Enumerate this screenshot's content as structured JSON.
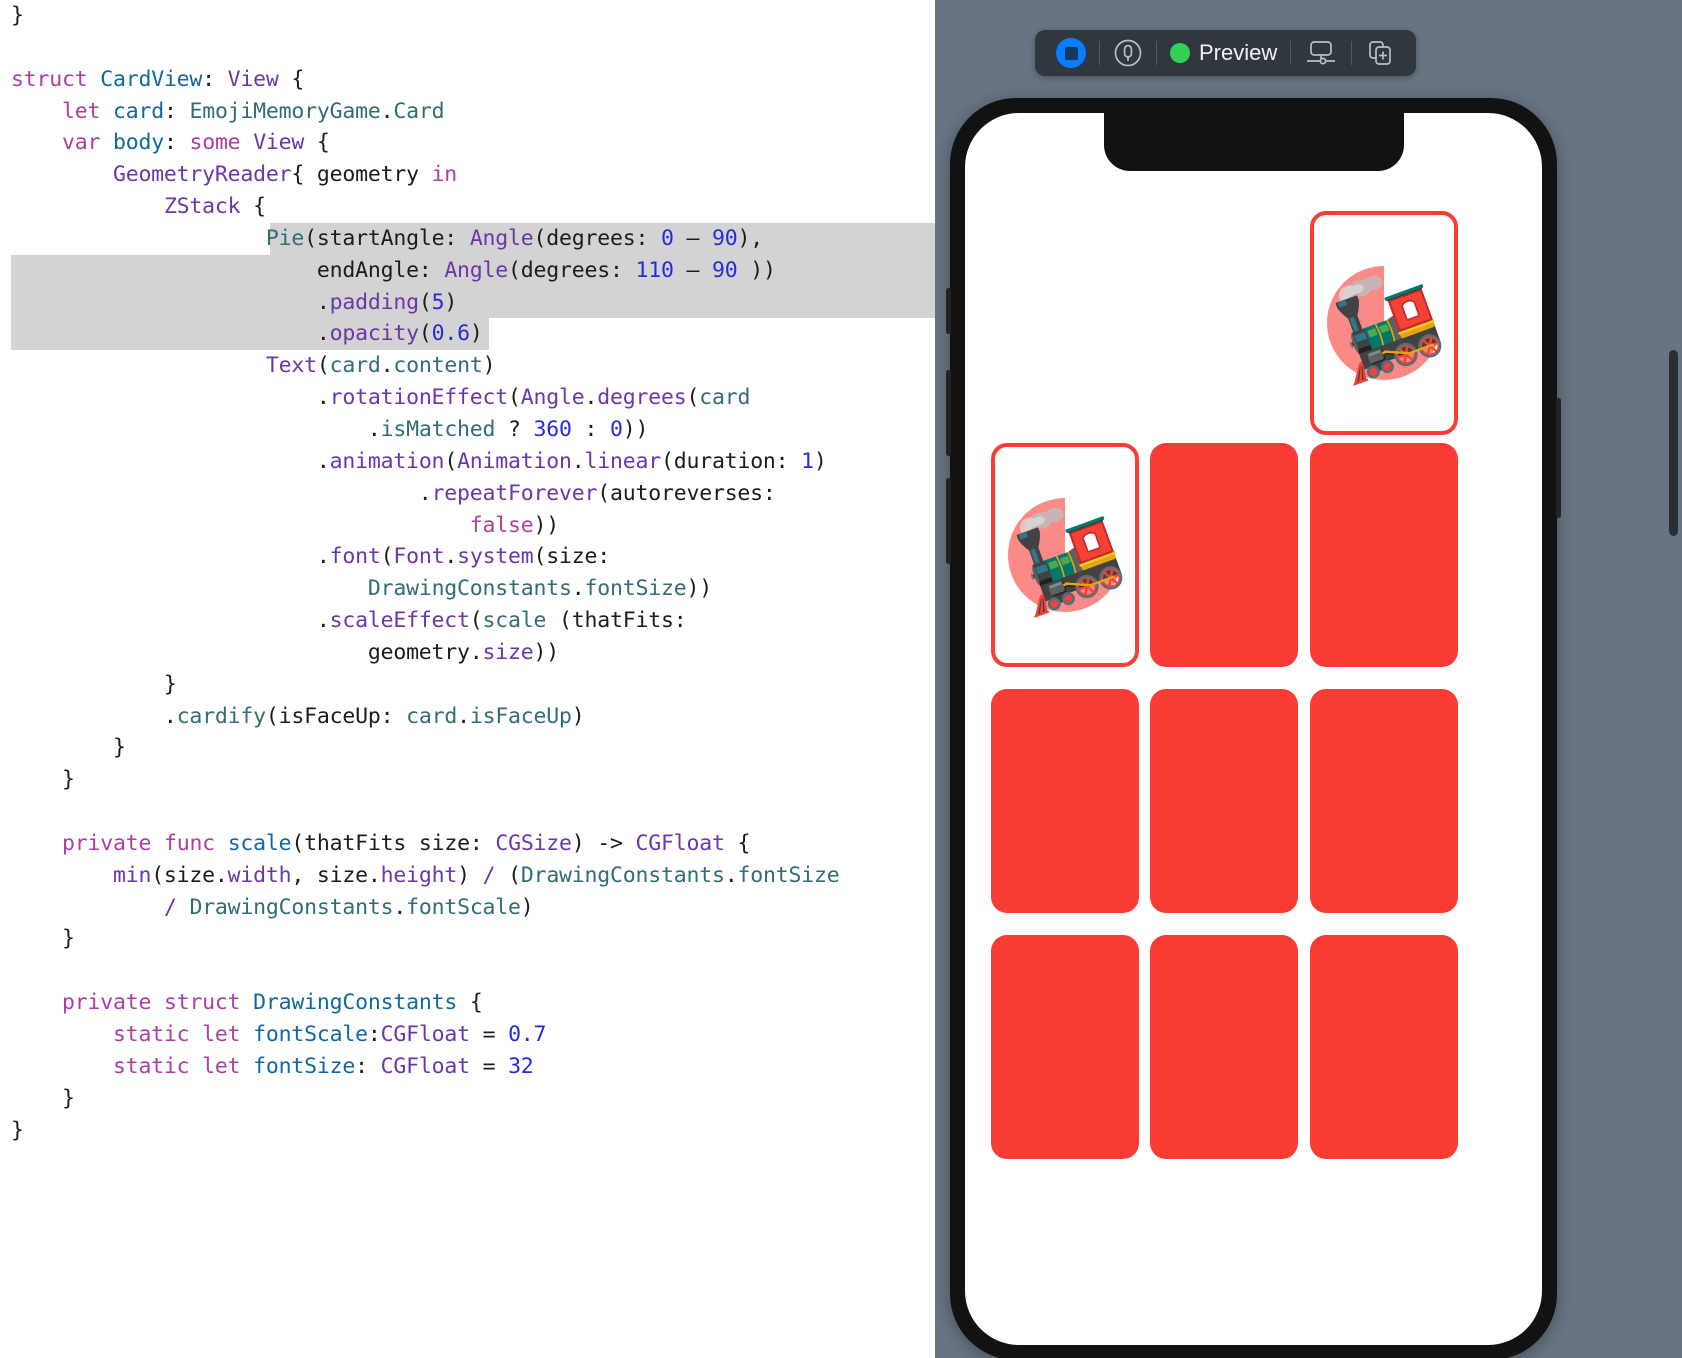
{
  "editor": {
    "language": "swift",
    "selection_highlight_color": "#d3d3d3",
    "lines": [
      {
        "id": 1,
        "selected": false,
        "tokens": [
          {
            "t": "}",
            "c": "pl"
          }
        ]
      },
      {
        "id": 2,
        "selected": false,
        "tokens": []
      },
      {
        "id": 3,
        "selected": false,
        "tokens": [
          {
            "t": "struct",
            "c": "kw"
          },
          {
            "t": " ",
            "c": "pl"
          },
          {
            "t": "CardView",
            "c": "decl"
          },
          {
            "t": ": ",
            "c": "pl"
          },
          {
            "t": "View",
            "c": "typ"
          },
          {
            "t": " {",
            "c": "pl"
          }
        ]
      },
      {
        "id": 4,
        "selected": false,
        "tokens": [
          {
            "t": "    ",
            "c": "pl"
          },
          {
            "t": "let",
            "c": "kw"
          },
          {
            "t": " ",
            "c": "pl"
          },
          {
            "t": "card",
            "c": "decl"
          },
          {
            "t": ": ",
            "c": "pl"
          },
          {
            "t": "EmojiMemoryGame",
            "c": "prop"
          },
          {
            "t": ".",
            "c": "pl"
          },
          {
            "t": "Card",
            "c": "prop"
          }
        ]
      },
      {
        "id": 5,
        "selected": false,
        "tokens": [
          {
            "t": "    ",
            "c": "pl"
          },
          {
            "t": "var",
            "c": "kw"
          },
          {
            "t": " ",
            "c": "pl"
          },
          {
            "t": "body",
            "c": "decl"
          },
          {
            "t": ": ",
            "c": "pl"
          },
          {
            "t": "some",
            "c": "kw"
          },
          {
            "t": " ",
            "c": "pl"
          },
          {
            "t": "View",
            "c": "typ"
          },
          {
            "t": " {",
            "c": "pl"
          }
        ]
      },
      {
        "id": 6,
        "selected": false,
        "tokens": [
          {
            "t": "        ",
            "c": "pl"
          },
          {
            "t": "GeometryReader",
            "c": "typ"
          },
          {
            "t": "{ geometry ",
            "c": "pl"
          },
          {
            "t": "in",
            "c": "kw"
          }
        ]
      },
      {
        "id": 7,
        "selected": false,
        "tokens": [
          {
            "t": "            ",
            "c": "pl"
          },
          {
            "t": "ZStack",
            "c": "typ"
          },
          {
            "t": " {",
            "c": "pl"
          }
        ]
      },
      {
        "id": 8,
        "selected": true,
        "sel_from": 20,
        "tokens": [
          {
            "t": "                    ",
            "c": "pl"
          },
          {
            "t": "Pie",
            "c": "prop"
          },
          {
            "t": "(startAngle: ",
            "c": "pl"
          },
          {
            "t": "Angle",
            "c": "typ"
          },
          {
            "t": "(degrees: ",
            "c": "pl"
          },
          {
            "t": "0",
            "c": "num"
          },
          {
            "t": " – ",
            "c": "pl"
          },
          {
            "t": "90",
            "c": "num"
          },
          {
            "t": "),",
            "c": "pl"
          }
        ]
      },
      {
        "id": 9,
        "selected": true,
        "sel_from": 0,
        "tokens": [
          {
            "t": "                        endAngle: ",
            "c": "pl"
          },
          {
            "t": "Angle",
            "c": "typ"
          },
          {
            "t": "(degrees: ",
            "c": "pl"
          },
          {
            "t": "110",
            "c": "num"
          },
          {
            "t": " – ",
            "c": "pl"
          },
          {
            "t": "90",
            "c": "num"
          },
          {
            "t": " ))",
            "c": "pl"
          }
        ]
      },
      {
        "id": 10,
        "selected": true,
        "sel_from": 0,
        "tokens": [
          {
            "t": "                        .",
            "c": "pl"
          },
          {
            "t": "padding",
            "c": "meth"
          },
          {
            "t": "(",
            "c": "pl"
          },
          {
            "t": "5",
            "c": "num"
          },
          {
            "t": ")",
            "c": "pl"
          }
        ]
      },
      {
        "id": 11,
        "selected": true,
        "sel_from": 0,
        "sel_to": 37,
        "tokens": [
          {
            "t": "                        .",
            "c": "pl"
          },
          {
            "t": "opacity",
            "c": "meth"
          },
          {
            "t": "(",
            "c": "pl"
          },
          {
            "t": "0.6",
            "c": "num"
          },
          {
            "t": ")",
            "c": "pl"
          }
        ]
      },
      {
        "id": 12,
        "selected": false,
        "tokens": [
          {
            "t": "                    ",
            "c": "pl"
          },
          {
            "t": "Text",
            "c": "typ"
          },
          {
            "t": "(",
            "c": "pl"
          },
          {
            "t": "card",
            "c": "prop"
          },
          {
            "t": ".",
            "c": "pl"
          },
          {
            "t": "content",
            "c": "prop"
          },
          {
            "t": ")",
            "c": "pl"
          }
        ]
      },
      {
        "id": 13,
        "selected": false,
        "tokens": [
          {
            "t": "                        .",
            "c": "pl"
          },
          {
            "t": "rotationEffect",
            "c": "meth"
          },
          {
            "t": "(",
            "c": "pl"
          },
          {
            "t": "Angle",
            "c": "typ"
          },
          {
            "t": ".",
            "c": "pl"
          },
          {
            "t": "degrees",
            "c": "meth"
          },
          {
            "t": "(",
            "c": "pl"
          },
          {
            "t": "card",
            "c": "prop"
          }
        ]
      },
      {
        "id": 14,
        "selected": false,
        "tokens": [
          {
            "t": "                            .",
            "c": "pl"
          },
          {
            "t": "isMatched",
            "c": "prop"
          },
          {
            "t": " ? ",
            "c": "pl"
          },
          {
            "t": "360",
            "c": "num"
          },
          {
            "t": " : ",
            "c": "pl"
          },
          {
            "t": "0",
            "c": "num"
          },
          {
            "t": "))",
            "c": "pl"
          }
        ]
      },
      {
        "id": 15,
        "selected": false,
        "tokens": [
          {
            "t": "                        .",
            "c": "pl"
          },
          {
            "t": "animation",
            "c": "meth"
          },
          {
            "t": "(",
            "c": "pl"
          },
          {
            "t": "Animation",
            "c": "typ"
          },
          {
            "t": ".",
            "c": "pl"
          },
          {
            "t": "linear",
            "c": "meth"
          },
          {
            "t": "(duration: ",
            "c": "pl"
          },
          {
            "t": "1",
            "c": "num"
          },
          {
            "t": ")",
            "c": "pl"
          }
        ]
      },
      {
        "id": 16,
        "selected": false,
        "tokens": [
          {
            "t": "                                .",
            "c": "pl"
          },
          {
            "t": "repeatForever",
            "c": "meth"
          },
          {
            "t": "(autoreverses:",
            "c": "pl"
          }
        ]
      },
      {
        "id": 17,
        "selected": false,
        "tokens": [
          {
            "t": "                                    ",
            "c": "pl"
          },
          {
            "t": "false",
            "c": "kw"
          },
          {
            "t": "))",
            "c": "pl"
          }
        ]
      },
      {
        "id": 18,
        "selected": false,
        "tokens": [
          {
            "t": "                        .",
            "c": "pl"
          },
          {
            "t": "font",
            "c": "meth"
          },
          {
            "t": "(",
            "c": "pl"
          },
          {
            "t": "Font",
            "c": "typ"
          },
          {
            "t": ".",
            "c": "pl"
          },
          {
            "t": "system",
            "c": "meth"
          },
          {
            "t": "(size:",
            "c": "pl"
          }
        ]
      },
      {
        "id": 19,
        "selected": false,
        "tokens": [
          {
            "t": "                            ",
            "c": "pl"
          },
          {
            "t": "DrawingConstants",
            "c": "prop"
          },
          {
            "t": ".",
            "c": "pl"
          },
          {
            "t": "fontSize",
            "c": "prop"
          },
          {
            "t": "))",
            "c": "pl"
          }
        ]
      },
      {
        "id": 20,
        "selected": false,
        "tokens": [
          {
            "t": "                        .",
            "c": "pl"
          },
          {
            "t": "scaleEffect",
            "c": "meth"
          },
          {
            "t": "(",
            "c": "pl"
          },
          {
            "t": "scale",
            "c": "prop"
          },
          {
            "t": " (thatFits:",
            "c": "pl"
          }
        ]
      },
      {
        "id": 21,
        "selected": false,
        "tokens": [
          {
            "t": "                            geometry.",
            "c": "pl"
          },
          {
            "t": "size",
            "c": "meth"
          },
          {
            "t": "))",
            "c": "pl"
          }
        ]
      },
      {
        "id": 22,
        "selected": false,
        "tokens": [
          {
            "t": "            }",
            "c": "pl"
          }
        ]
      },
      {
        "id": 23,
        "selected": false,
        "tokens": [
          {
            "t": "            .",
            "c": "pl"
          },
          {
            "t": "cardify",
            "c": "prop"
          },
          {
            "t": "(isFaceUp: ",
            "c": "pl"
          },
          {
            "t": "card",
            "c": "prop"
          },
          {
            "t": ".",
            "c": "pl"
          },
          {
            "t": "isFaceUp",
            "c": "prop"
          },
          {
            "t": ")",
            "c": "pl"
          }
        ]
      },
      {
        "id": 24,
        "selected": false,
        "tokens": [
          {
            "t": "        }",
            "c": "pl"
          }
        ]
      },
      {
        "id": 25,
        "selected": false,
        "tokens": [
          {
            "t": "    }",
            "c": "pl"
          }
        ]
      },
      {
        "id": 26,
        "selected": false,
        "tokens": []
      },
      {
        "id": 27,
        "selected": false,
        "tokens": [
          {
            "t": "    ",
            "c": "pl"
          },
          {
            "t": "private",
            "c": "kw"
          },
          {
            "t": " ",
            "c": "pl"
          },
          {
            "t": "func",
            "c": "kw"
          },
          {
            "t": " ",
            "c": "pl"
          },
          {
            "t": "scale",
            "c": "decl"
          },
          {
            "t": "(thatFits size: ",
            "c": "pl"
          },
          {
            "t": "CGSize",
            "c": "typ"
          },
          {
            "t": ") -> ",
            "c": "pl"
          },
          {
            "t": "CGFloat",
            "c": "typ"
          },
          {
            "t": " {",
            "c": "pl"
          }
        ]
      },
      {
        "id": 28,
        "selected": false,
        "tokens": [
          {
            "t": "        ",
            "c": "pl"
          },
          {
            "t": "min",
            "c": "meth"
          },
          {
            "t": "(size.",
            "c": "pl"
          },
          {
            "t": "width",
            "c": "meth"
          },
          {
            "t": ", size.",
            "c": "pl"
          },
          {
            "t": "height",
            "c": "meth"
          },
          {
            "t": ") ",
            "c": "pl"
          },
          {
            "t": "/",
            "c": "meth"
          },
          {
            "t": " (",
            "c": "pl"
          },
          {
            "t": "DrawingConstants",
            "c": "prop"
          },
          {
            "t": ".",
            "c": "pl"
          },
          {
            "t": "fontSize",
            "c": "prop"
          }
        ]
      },
      {
        "id": 29,
        "selected": false,
        "tokens": [
          {
            "t": "            ",
            "c": "pl"
          },
          {
            "t": "/",
            "c": "meth"
          },
          {
            "t": " ",
            "c": "pl"
          },
          {
            "t": "DrawingConstants",
            "c": "prop"
          },
          {
            "t": ".",
            "c": "pl"
          },
          {
            "t": "fontScale",
            "c": "prop"
          },
          {
            "t": ")",
            "c": "pl"
          }
        ]
      },
      {
        "id": 30,
        "selected": false,
        "tokens": [
          {
            "t": "    }",
            "c": "pl"
          }
        ]
      },
      {
        "id": 31,
        "selected": false,
        "tokens": []
      },
      {
        "id": 32,
        "selected": false,
        "tokens": [
          {
            "t": "    ",
            "c": "pl"
          },
          {
            "t": "private",
            "c": "kw"
          },
          {
            "t": " ",
            "c": "pl"
          },
          {
            "t": "struct",
            "c": "kw"
          },
          {
            "t": " ",
            "c": "pl"
          },
          {
            "t": "DrawingConstants",
            "c": "decl"
          },
          {
            "t": " {",
            "c": "pl"
          }
        ]
      },
      {
        "id": 33,
        "selected": false,
        "tokens": [
          {
            "t": "        ",
            "c": "pl"
          },
          {
            "t": "static",
            "c": "kw"
          },
          {
            "t": " ",
            "c": "pl"
          },
          {
            "t": "let",
            "c": "kw"
          },
          {
            "t": " ",
            "c": "pl"
          },
          {
            "t": "fontScale",
            "c": "decl"
          },
          {
            "t": ":",
            "c": "pl"
          },
          {
            "t": "CGFloat",
            "c": "typ"
          },
          {
            "t": " = ",
            "c": "pl"
          },
          {
            "t": "0.7",
            "c": "num"
          }
        ]
      },
      {
        "id": 34,
        "selected": false,
        "tokens": [
          {
            "t": "        ",
            "c": "pl"
          },
          {
            "t": "static",
            "c": "kw"
          },
          {
            "t": " ",
            "c": "pl"
          },
          {
            "t": "let",
            "c": "kw"
          },
          {
            "t": " ",
            "c": "pl"
          },
          {
            "t": "fontSize",
            "c": "decl"
          },
          {
            "t": ": ",
            "c": "pl"
          },
          {
            "t": "CGFloat",
            "c": "typ"
          },
          {
            "t": " = ",
            "c": "pl"
          },
          {
            "t": "32",
            "c": "num"
          }
        ]
      },
      {
        "id": 35,
        "selected": false,
        "tokens": [
          {
            "t": "    }",
            "c": "pl"
          }
        ]
      },
      {
        "id": 36,
        "selected": false,
        "tokens": [
          {
            "t": "}",
            "c": "pl"
          }
        ]
      }
    ]
  },
  "preview": {
    "background_color": "#687483",
    "toolbar": {
      "background_color": "#30373f",
      "items": [
        {
          "name": "stop-preview-button",
          "icon": "blue-stop-square-icon",
          "label": ""
        },
        {
          "name": "device-settings-button",
          "icon": "phone-in-circle-icon",
          "label": ""
        },
        {
          "name": "preview-status",
          "icon": "green-status-dot",
          "label": "Preview"
        },
        {
          "name": "display-settings-button",
          "icon": "display-with-slider-icon",
          "label": ""
        },
        {
          "name": "duplicate-preview-button",
          "icon": "add-duplicate-icon",
          "label": ""
        }
      ]
    },
    "device": {
      "frame_color": "#121212",
      "screen_color": "#ffffff",
      "accent_color": "#fa3c36"
    },
    "cards": [
      {
        "index": 0,
        "face_up": true,
        "content": "🚂",
        "pie_opacity": 0.6,
        "pie_start_deg": -90,
        "pie_end_deg": 20,
        "row": 0,
        "col": 2
      },
      {
        "index": 1,
        "face_up": true,
        "content": "🚂",
        "pie_opacity": 0.6,
        "pie_start_deg": -90,
        "pie_end_deg": 20,
        "row": 1,
        "col": 0
      },
      {
        "index": 2,
        "face_up": false,
        "content": "",
        "row": 1,
        "col": 1
      },
      {
        "index": 3,
        "face_up": false,
        "content": "",
        "row": 1,
        "col": 2
      },
      {
        "index": 4,
        "face_up": false,
        "content": "",
        "row": 2,
        "col": 0
      },
      {
        "index": 5,
        "face_up": false,
        "content": "",
        "row": 2,
        "col": 1
      },
      {
        "index": 6,
        "face_up": false,
        "content": "",
        "row": 2,
        "col": 2
      },
      {
        "index": 7,
        "face_up": false,
        "content": "",
        "row": 3,
        "col": 0
      },
      {
        "index": 8,
        "face_up": false,
        "content": "",
        "row": 3,
        "col": 1
      },
      {
        "index": 9,
        "face_up": false,
        "content": "",
        "row": 3,
        "col": 2
      }
    ]
  }
}
